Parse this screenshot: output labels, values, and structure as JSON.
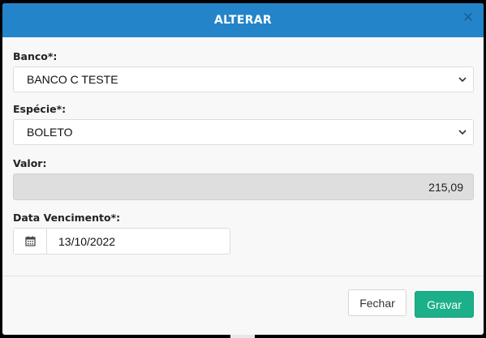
{
  "header": {
    "title": "ALTERAR",
    "close_glyph": "✕"
  },
  "form": {
    "banco": {
      "label": "Banco*:",
      "value": "BANCO C TESTE"
    },
    "especie": {
      "label": "Espécie*:",
      "value": "BOLETO"
    },
    "valor": {
      "label": "Valor:",
      "value": "215,09"
    },
    "vencimento": {
      "label": "Data Vencimento*:",
      "value": "13/10/2022"
    }
  },
  "footer": {
    "close_label": "Fechar",
    "save_label": "Gravar"
  },
  "colors": {
    "header": "#2384c9",
    "save_button": "#1cb08a"
  },
  "icons": {
    "close": "close-icon",
    "chevron": "chevron-down-icon",
    "calendar": "calendar-icon"
  }
}
